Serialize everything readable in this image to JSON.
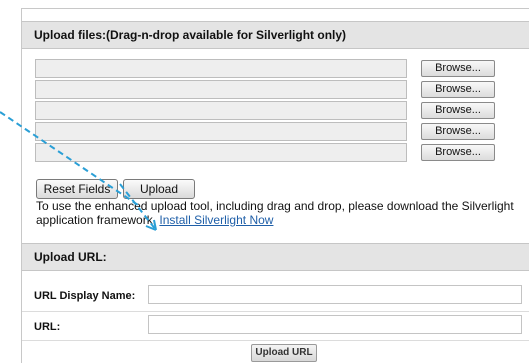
{
  "upload_files": {
    "header": "Upload files:(Drag-n-drop available for Silverlight only)",
    "browse_label": "Browse...",
    "rows": [
      {
        "value": ""
      },
      {
        "value": ""
      },
      {
        "value": ""
      },
      {
        "value": ""
      },
      {
        "value": ""
      }
    ],
    "reset_label": "Reset Fields",
    "upload_label": "Upload",
    "help_text": "To use the enhanced upload tool, including drag and drop, please download the Silverlight application framework.",
    "install_link": "Install Silverlight Now"
  },
  "upload_url": {
    "header": "Upload URL:",
    "display_name_label": "URL Display Name:",
    "display_name_value": "",
    "url_label": "URL:",
    "url_value": "",
    "button_label": "Upload URL"
  },
  "annotation": {
    "color": "#2a9fd6",
    "icon": "dashed-arrow-icon"
  }
}
